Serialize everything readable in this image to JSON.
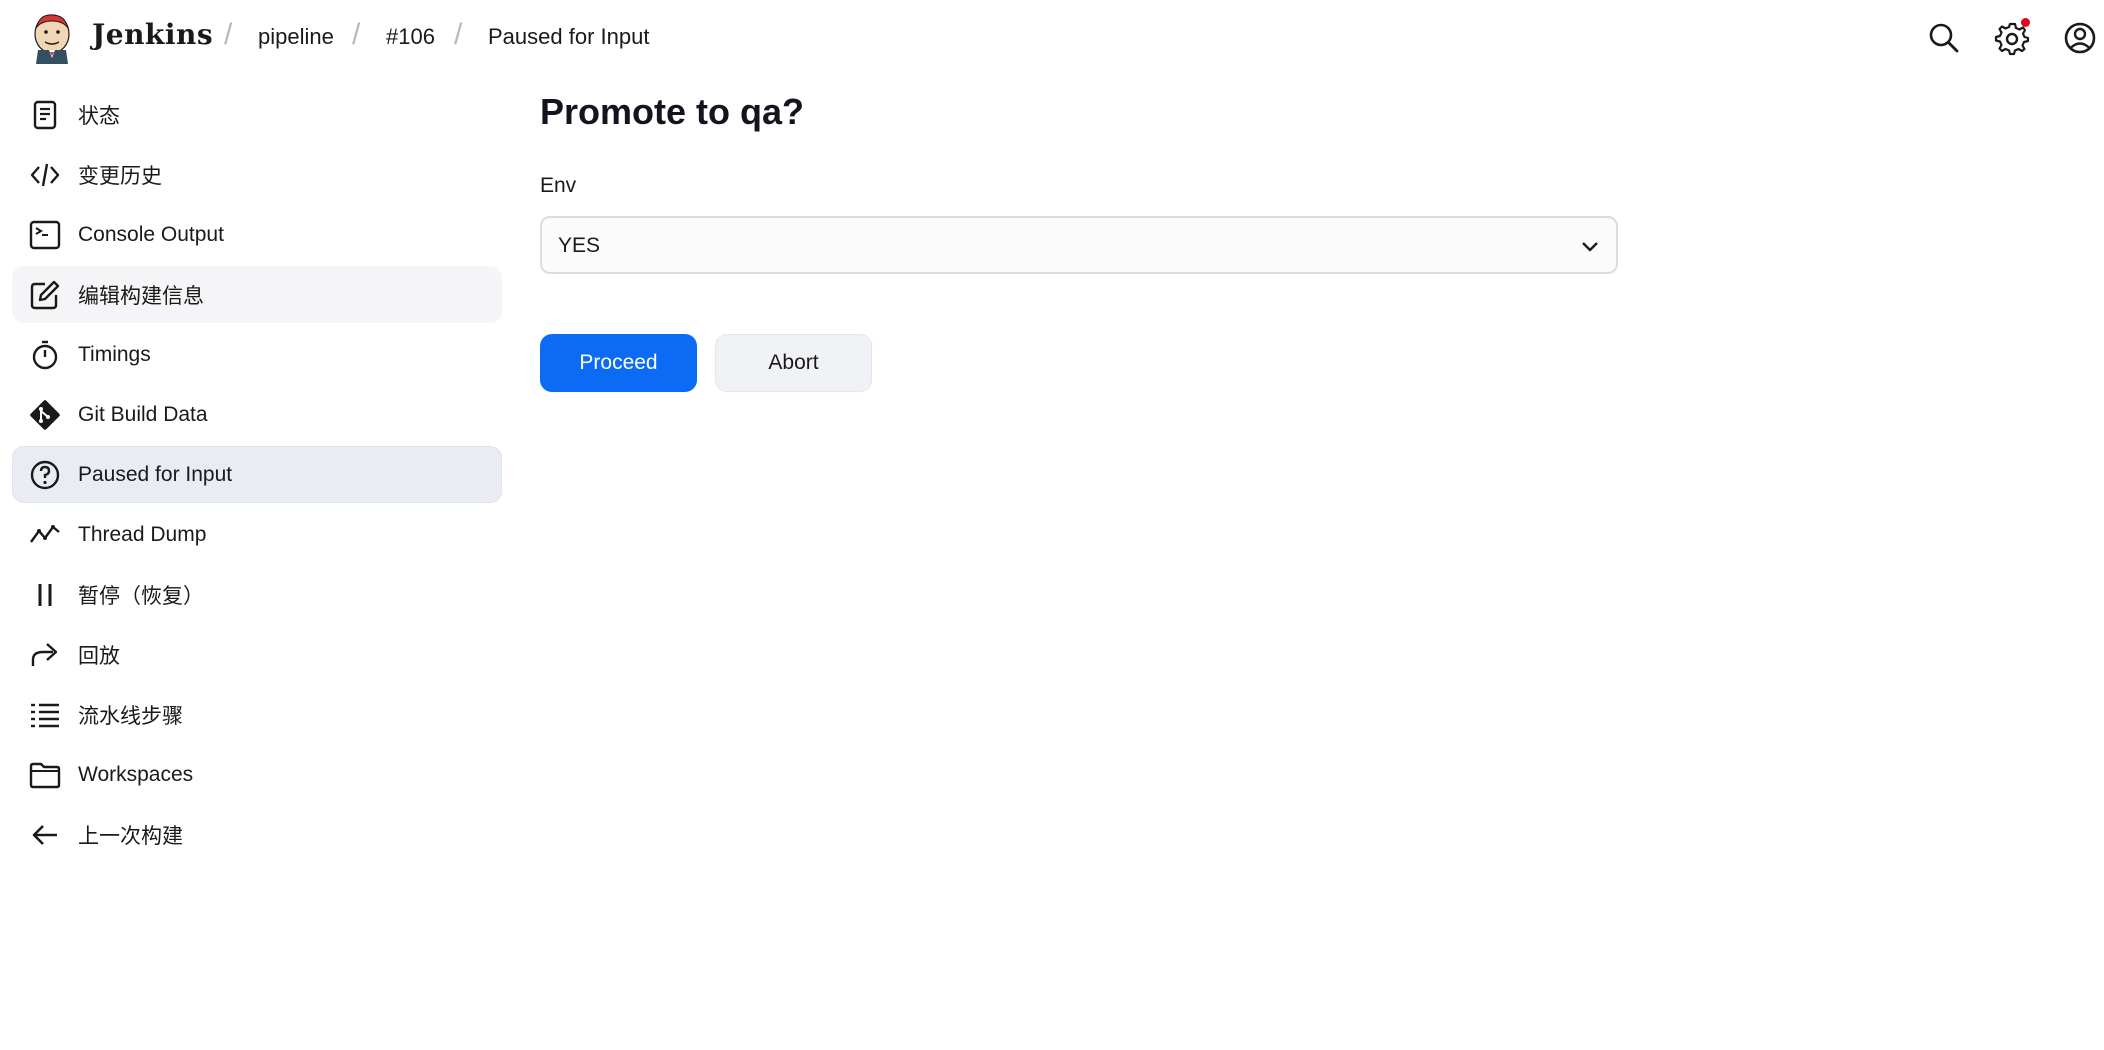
{
  "header": {
    "brand": "Jenkins",
    "breadcrumbs": [
      "pipeline",
      "#106",
      "Paused for Input"
    ],
    "icons": [
      "search-icon",
      "settings-icon",
      "user-icon"
    ],
    "notification_color": "#e6001f"
  },
  "sidebar": {
    "items": [
      {
        "label": "状态",
        "icon": "status-document-icon"
      },
      {
        "label": "变更历史",
        "icon": "code-icon"
      },
      {
        "label": "Console Output",
        "icon": "terminal-icon"
      },
      {
        "label": "编辑构建信息",
        "icon": "edit-icon"
      },
      {
        "label": "Timings",
        "icon": "stopwatch-icon"
      },
      {
        "label": "Git Build Data",
        "icon": "git-icon"
      },
      {
        "label": "Paused for Input",
        "icon": "help-circle-icon"
      },
      {
        "label": "Thread Dump",
        "icon": "activity-icon"
      },
      {
        "label": "暂停（恢复）",
        "icon": "pause-icon"
      },
      {
        "label": "回放",
        "icon": "redo-icon"
      },
      {
        "label": "流水线步骤",
        "icon": "list-steps-icon"
      },
      {
        "label": "Workspaces",
        "icon": "folder-icon"
      },
      {
        "label": "上一次构建",
        "icon": "arrow-left-icon"
      }
    ],
    "active_index": 6
  },
  "main": {
    "title": "Promote to qa?",
    "field_label": "Env",
    "select_value": "YES",
    "proceed_label": "Proceed",
    "abort_label": "Abort",
    "accent_color": "#0b6bf5"
  }
}
